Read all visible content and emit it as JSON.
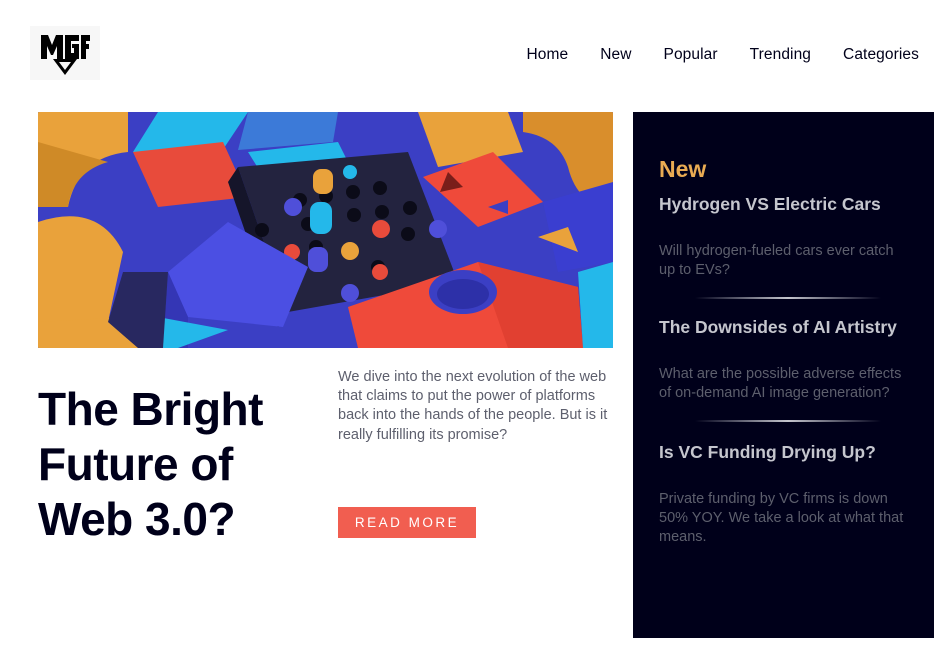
{
  "logo": {
    "text": "MGF",
    "colors": {
      "fill": "#000000"
    }
  },
  "nav": {
    "items": [
      {
        "label": "Home"
      },
      {
        "label": "New"
      },
      {
        "label": "Popular"
      },
      {
        "label": "Trending"
      },
      {
        "label": "Categories"
      }
    ]
  },
  "main": {
    "hero_image": "abstract-3d-blocks-image",
    "title": "The Bright Future of Web 3.0?",
    "description": "We dive into the next evolution of the web that claims to put the power of platforms back into the hands of the people. But is it really fulfilling its promise?",
    "cta_label": "READ MORE"
  },
  "sidebar": {
    "heading": "New",
    "items": [
      {
        "title": "Hydrogen VS Electric Cars",
        "description": "Will hydrogen-fueled cars ever catch up to EVs?"
      },
      {
        "title": "The Downsides of AI Artistry",
        "description": "What are the possible adverse effects of on-demand AI image generation?"
      },
      {
        "title": "Is VC Funding Drying Up?",
        "description": "Private funding by VC firms is down 50% YOY. We take a look at what that means."
      }
    ]
  },
  "colors": {
    "dark_navy": "#00001a",
    "accent_orange": "#e9ab53",
    "accent_red": "#f15e50",
    "muted_gray": "#5d5f6d",
    "light_gray": "#c5c6ce"
  }
}
